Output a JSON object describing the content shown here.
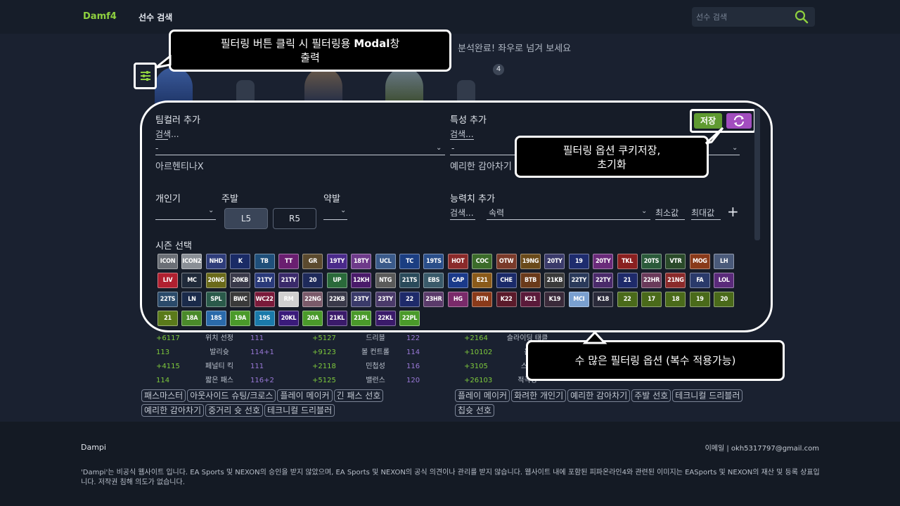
{
  "header": {
    "logo": "Damf4",
    "nav_search": "선수 검색",
    "search_placeholder": "선수 검색"
  },
  "main": {
    "analysis_text": "분석완료! 좌우로 넘겨 보세요",
    "badge": "4"
  },
  "callouts": {
    "filter_btn": {
      "line1_pre": "필터링 버튼 클릭 시 필터링용 ",
      "line1_bold": "Modal",
      "line1_post": "창",
      "line2": "출력"
    },
    "cookie": {
      "line1": "필터링 옵션 쿠키저장,",
      "line2": "초기화"
    },
    "options": "수 많은 필터링 옵션 (복수 적용가능)"
  },
  "modal": {
    "team_color_label": "팀컬러 추가",
    "team_search": "검색...",
    "team_select": "-",
    "team_applied": "아르헨티나X",
    "trait_label": "특성 추가",
    "trait_search": "검색...",
    "trait_select": "-",
    "trait_applied": "예리한 감아차기",
    "popularity_label": "개인기",
    "strong_foot_label": "주발",
    "weak_foot_label": "약발",
    "strong_l": "L5",
    "strong_r": "R5",
    "ability_label": "능력치 추가",
    "ability_search": "검색...",
    "ability_select": "속력",
    "min_label": "최소값",
    "max_label": "최대값",
    "plus": "+",
    "season_label": "시즌 선택",
    "save_btn": "저장"
  },
  "seasons": [
    [
      "ICON",
      "#6b6f76"
    ],
    [
      "ICON2",
      "#8a8f96"
    ],
    [
      "NHD",
      "#2e3c7a"
    ],
    [
      "K",
      "#1a2b66"
    ],
    [
      "TB",
      "#1f4f7a"
    ],
    [
      "TT",
      "#6a1e70"
    ],
    [
      "GR",
      "#5b4a2e"
    ],
    [
      "19TY",
      "#4a2a8a"
    ],
    [
      "18TY",
      "#6e3a8a"
    ],
    [
      "UCL",
      "#3a5a8a"
    ],
    [
      "TC",
      "#1b3e82"
    ],
    [
      "19TS",
      "#2a4e8a"
    ],
    [
      "HOT",
      "#8a2a2a"
    ],
    [
      "COC",
      "#3b6b2a"
    ],
    [
      "OTW",
      "#7a3a2a"
    ],
    [
      "19NG",
      "#6a4a1a"
    ],
    [
      "20TY",
      "#3a3a6a"
    ],
    [
      "19",
      "#1e2c6e"
    ],
    [
      "20TY",
      "#6a2a7a"
    ],
    [
      "TKL",
      "#8a2020"
    ],
    [
      "20TS",
      "#2a5a3a"
    ],
    [
      "VTR",
      "#2a4a2a"
    ],
    [
      "MOG",
      "#8a3a1a"
    ],
    [
      "LH",
      "#4a5a7a"
    ],
    [
      "LIV",
      "#b02030"
    ],
    [
      "MC",
      "#202a3a"
    ],
    [
      "20NG",
      "#6a6a1a"
    ],
    [
      "20KB",
      "#3a3a4a"
    ],
    [
      "21TY",
      "#2a3a7a"
    ],
    [
      "21TY",
      "#3a2a6a"
    ],
    [
      "20",
      "#1e2a5a"
    ],
    [
      "UP",
      "#2a6a3a"
    ],
    [
      "12KH",
      "#4a1a6a"
    ],
    [
      "NTG",
      "#5a5a5a"
    ],
    [
      "21TS",
      "#2a4a5a"
    ],
    [
      "EBS",
      "#3a5a6a"
    ],
    [
      "CAP",
      "#1a3a8a"
    ],
    [
      "E21",
      "#8a5a1a"
    ],
    [
      "CHE",
      "#1a2a6a"
    ],
    [
      "BTB",
      "#6a3a1a"
    ],
    [
      "21KB",
      "#3a3a3a"
    ],
    [
      "22TY",
      "#2a3a5a"
    ],
    [
      "22TY",
      "#4a2a6a"
    ],
    [
      "21",
      "#1e2a6a"
    ],
    [
      "22HR",
      "#6a3a5a"
    ],
    [
      "21NG",
      "#8a2a2a"
    ],
    [
      "FA",
      "#2a3a6a"
    ],
    [
      "LOL",
      "#5a2a7a"
    ],
    [
      "22TS",
      "#2a4a6a"
    ],
    [
      "LN",
      "#1a2a4a"
    ],
    [
      "SPL",
      "#2a5a4a"
    ],
    [
      "BWC",
      "#3a3a3a"
    ],
    [
      "WC22",
      "#7a1a3a"
    ],
    [
      "RM",
      "#d0d0d0"
    ],
    [
      "22NG",
      "#7a5a6a"
    ],
    [
      "22KB",
      "#3a3a4a"
    ],
    [
      "23TY",
      "#3a3a6a"
    ],
    [
      "23TY",
      "#4a3a6a"
    ],
    [
      "22",
      "#1e2a6a"
    ],
    [
      "23HR",
      "#5a3a6a"
    ],
    [
      "HG",
      "#7a2a6a"
    ],
    [
      "RTN",
      "#8a3a1a"
    ],
    [
      "K22",
      "#5a1a2a"
    ],
    [
      "K21",
      "#5a1a3a"
    ],
    [
      "K19",
      "#3a2a3a"
    ],
    [
      "MCI",
      "#7aa0d0"
    ],
    [
      "K18",
      "#2a2a3a"
    ],
    [
      "22",
      "#4a6a1a"
    ],
    [
      "17",
      "#4a6a1a"
    ],
    [
      "18",
      "#4a6a1a"
    ],
    [
      "19",
      "#4a6a1a"
    ],
    [
      "20",
      "#4a6a1a"
    ],
    [
      "21",
      "#5a7a1a"
    ],
    [
      "18A",
      "#4a8a2a"
    ],
    [
      "18S",
      "#2a6aaa"
    ],
    [
      "19A",
      "#4a9a2a"
    ],
    [
      "19S",
      "#1a7aaa"
    ],
    [
      "20KL",
      "#3a1a7a"
    ],
    [
      "20A",
      "#4a9a2a"
    ],
    [
      "21KL",
      "#3a1a6a"
    ],
    [
      "21PL",
      "#4a9a2a"
    ],
    [
      "22KL",
      "#3a1a6a"
    ],
    [
      "22PL",
      "#4a9a2a"
    ]
  ],
  "stats": {
    "col1": [
      [
        "+6117",
        "위치 선정",
        "111"
      ],
      [
        "113",
        "발리슛",
        "114+1"
      ],
      [
        "+4115",
        "페널티 킥",
        "111"
      ],
      [
        "114",
        "짧은 패스",
        "116+2"
      ]
    ],
    "col2": [
      [
        "+5127",
        "드리블",
        "122"
      ],
      [
        "+9123",
        "볼 컨트롤",
        "114"
      ],
      [
        "+2118",
        "민첩성",
        "116"
      ],
      [
        "+5125",
        "밸런스",
        "120"
      ]
    ],
    "col3": [
      [
        "+2164",
        "슬라이딩 태클",
        ""
      ],
      [
        "+10102",
        "몸",
        ""
      ],
      [
        "+3105",
        "스태",
        ""
      ],
      [
        "+26103",
        "적극성",
        ""
      ]
    ]
  },
  "tags_left": [
    "패스마스터",
    "아웃사이드 슈팅/크로스",
    "플레이 메이커",
    "긴 패스 선호",
    "예리한 감아차기",
    "중거리 슛 선호",
    "테크니컬 드리블러"
  ],
  "tags_right": [
    "플레이 메이커",
    "화려한 개인기",
    "예리한 감아차기",
    "주발 선호",
    "테크니컬 드리블러",
    "칩슛 선호"
  ],
  "footer": {
    "title": "Dampi",
    "email": "이메일 | okh5317797@gmail.com",
    "note": "'Dampi'는 비공식 웹사이트 입니다. EA Sports 및 NEXON의 승인을 받지 않았으며, EA Sports 및 NEXON의 공식 의견이나 관리를 받지 않습니다. 웹사이트 내에 포함된 피파온라인4와 관련된 이미지는 EASports 및 NEXON의 재산 및 등록 상표입니다. 저작권 침해 의도가 없습니다."
  },
  "colors": {
    "brand": "#8fd13f",
    "save": "#5f9a31",
    "reset": "#a24dbf"
  }
}
